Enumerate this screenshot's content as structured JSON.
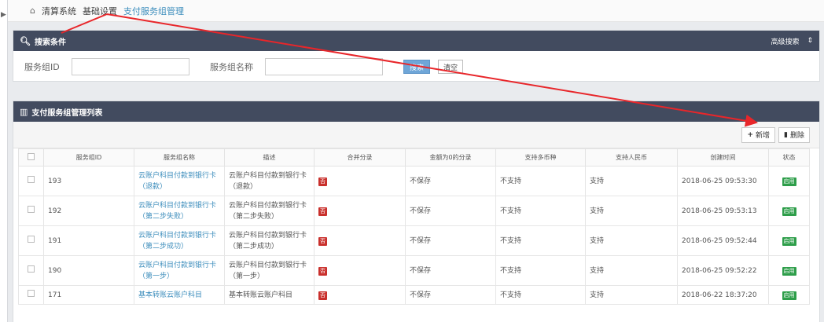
{
  "breadcrumb": {
    "items": [
      "清算系统",
      "基础设置",
      "支付服务组管理"
    ]
  },
  "search": {
    "title": "搜索条件",
    "advanced_label": "高级搜索",
    "fields": [
      {
        "label": "服务组ID",
        "value": "",
        "placeholder": ""
      },
      {
        "label": "服务组名称",
        "value": "",
        "placeholder": ""
      }
    ],
    "search_button": "搜索",
    "clear_button": "清空"
  },
  "list": {
    "title": "支付服务组管理列表",
    "add_button": "新增",
    "delete_button": "删除",
    "columns": [
      "服务组ID",
      "服务组名称",
      "描述",
      "合并分录",
      "金额为0的分录",
      "支持多币种",
      "支持人民币",
      "创建时间",
      "状态"
    ],
    "rows": [
      {
        "id": "193",
        "name": "云账户科目付款到银行卡（退款）",
        "desc": "云账户科目付款到银行卡（退款）",
        "badge": "否",
        "zero": "不保存",
        "multi": "不支持",
        "rmb": "支持",
        "created": "2018-06-25 09:53:30",
        "status": "启用"
      },
      {
        "id": "192",
        "name": "云账户科目付款到银行卡（第二步失败）",
        "desc": "云账户科目付款到银行卡（第二步失败）",
        "badge": "否",
        "zero": "不保存",
        "multi": "不支持",
        "rmb": "支持",
        "created": "2018-06-25 09:53:13",
        "status": "启用"
      },
      {
        "id": "191",
        "name": "云账户科目付款到银行卡（第二步成功）",
        "desc": "云账户科目付款到银行卡（第二步成功）",
        "badge": "否",
        "zero": "不保存",
        "multi": "不支持",
        "rmb": "支持",
        "created": "2018-06-25 09:52:44",
        "status": "启用"
      },
      {
        "id": "190",
        "name": "云账户科目付款到银行卡（第一步）",
        "desc": "云账户科目付款到银行卡（第一步）",
        "badge": "否",
        "zero": "不保存",
        "multi": "不支持",
        "rmb": "支持",
        "created": "2018-06-25 09:52:22",
        "status": "启用"
      },
      {
        "id": "171",
        "name": "基本转账云账户科目",
        "desc": "基本转账云账户科目",
        "badge": "否",
        "zero": "不保存",
        "multi": "不支持",
        "rmb": "支持",
        "created": "2018-06-22 18:37:20",
        "status": "启用"
      }
    ]
  },
  "colors": {
    "header_bg": "#424b5f",
    "link": "#3c8dbc",
    "annotation_arrow": "#e8262a",
    "status_green": "#2e9e4a",
    "badge_red": "#c9302c"
  }
}
